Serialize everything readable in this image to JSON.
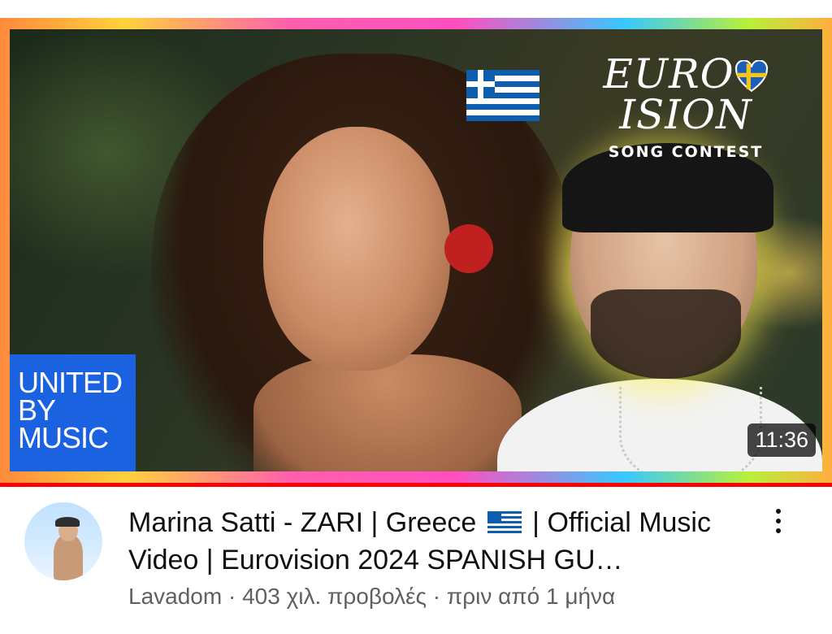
{
  "thumbnail": {
    "overlay_badge": "UNITED\nBY\nMUSIC",
    "logo_text": "EURO",
    "logo_text_2": "ISION",
    "logo_sub": "SONG CONTEST",
    "duration": "11:36",
    "flag_icon": "greece-flag-icon",
    "accent_progress_color": "#ff0000"
  },
  "video": {
    "title_part1": "Marina Satti - ZARI | Greece ",
    "title_part2": " | Official Music Video | Eurovision 2024 SPANISH GU…",
    "channel": "Lavadom",
    "separator": " · ",
    "views": "403 χιλ. προβολές",
    "age": "πριν από 1 μήνα"
  }
}
